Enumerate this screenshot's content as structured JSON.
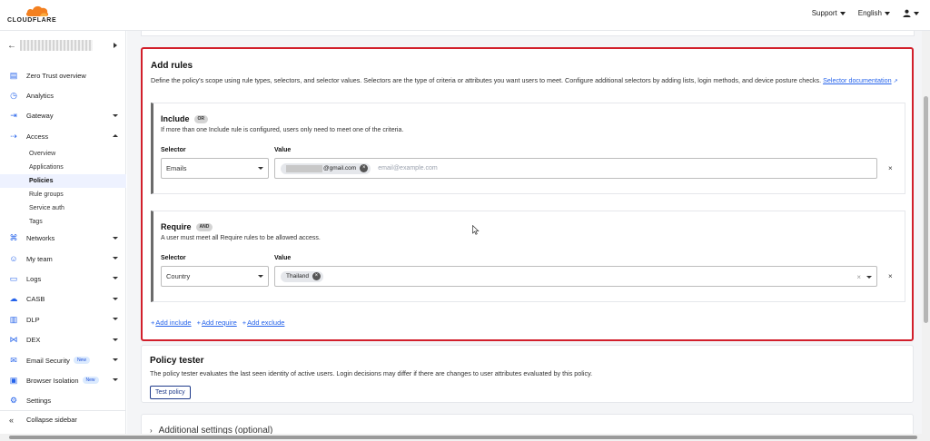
{
  "topbar": {
    "logo_text": "CLOUDFLARE",
    "support": "Support",
    "language": "English"
  },
  "sidebar": {
    "items": [
      {
        "label": "Zero Trust overview",
        "icon": "dashboard-icon"
      },
      {
        "label": "Analytics",
        "icon": "analytics-icon"
      },
      {
        "label": "Gateway",
        "icon": "gateway-icon"
      },
      {
        "label": "Access",
        "icon": "access-icon"
      },
      {
        "label": "Networks",
        "icon": "networks-icon"
      },
      {
        "label": "My team",
        "icon": "team-icon"
      },
      {
        "label": "Logs",
        "icon": "logs-icon"
      },
      {
        "label": "CASB",
        "icon": "casb-icon"
      },
      {
        "label": "DLP",
        "icon": "dlp-icon"
      },
      {
        "label": "DEX",
        "icon": "dex-icon"
      },
      {
        "label": "Email Security",
        "icon": "email-icon",
        "badge": "New"
      },
      {
        "label": "Browser Isolation",
        "icon": "browser-icon",
        "badge": "New"
      },
      {
        "label": "Settings",
        "icon": "gear-icon"
      }
    ],
    "access_sub": [
      "Overview",
      "Applications",
      "Policies",
      "Rule groups",
      "Service auth",
      "Tags"
    ],
    "collapse_label": "Collapse sidebar"
  },
  "rules": {
    "title": "Add rules",
    "description": "Define the policy's scope using rule types, selectors, and selector values. Selectors are the type of criteria or attributes you want users to meet. Configure additional selectors by adding lists, login methods, and device posture checks.",
    "doc_link": "Selector documentation",
    "include": {
      "title": "Include",
      "pill": "OR",
      "description": "If more than one Include rule is configured, users only need to meet one of the criteria.",
      "selector_label": "Selector",
      "value_label": "Value",
      "selector_value": "Emails",
      "chip_text": "@gmail.com",
      "placeholder": "email@example.com"
    },
    "require": {
      "title": "Require",
      "pill": "AND",
      "description": "A user must meet all Require rules to be allowed access.",
      "selector_label": "Selector",
      "value_label": "Value",
      "selector_value": "Country",
      "chip_text": "Thailand"
    },
    "add_include": "Add include",
    "add_require": "Add require",
    "add_exclude": "Add exclude"
  },
  "tester": {
    "title": "Policy tester",
    "description": "The policy tester evaluates the last seen identity of active users. Login decisions may differ if there are changes to user attributes evaluated by this policy.",
    "button": "Test policy"
  },
  "additional": {
    "title": "Additional settings (optional)"
  },
  "colors": {
    "accent": "#2563eb",
    "highlight_border": "#d21f2b",
    "logo_orange": "#f38020"
  }
}
